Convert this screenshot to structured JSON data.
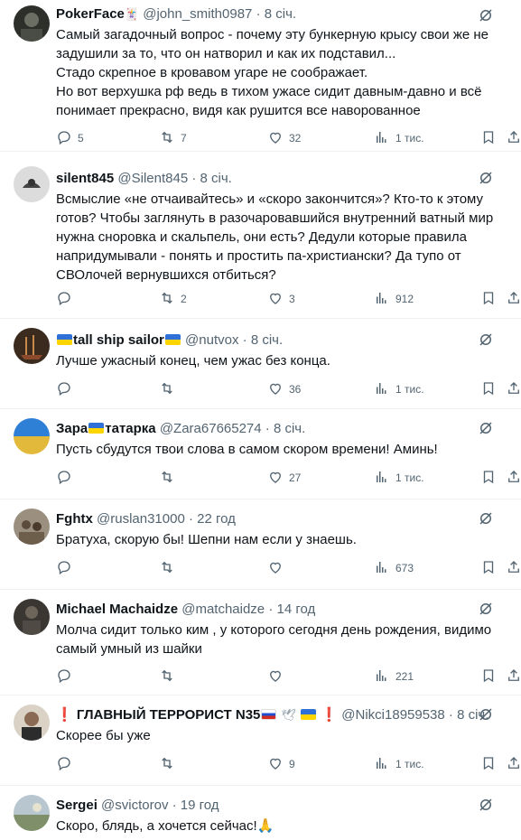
{
  "posts": [
    {
      "name": "PokerFace",
      "name_badge": "🃏",
      "handle": "@john_smith0987",
      "dot": "·",
      "time": "8 січ.",
      "text": "Самый загадочный вопрос - почему эту бункерную крысу свои же не\nзадушили за то, что он натворил и как их подставил...\nСтадо скрепное в кровавом угаре не соображает.\nНо вот верхушка рф ведь в тихом ужасе сидит давным-давно и всё\nпонимает прекрасно, видя как рушится все наворованное",
      "replies": "5",
      "reposts": "7",
      "likes": "32",
      "views": "1 тис."
    },
    {
      "name": "silent845",
      "handle": "@Silent845",
      "dot": "·",
      "time": "8 січ.",
      "text": "Всмыслие «не отчаивайтесь» и «скоро закончится»? Кто-то к этому\nготов? Чтобы заглянуть в разочаровавшийся внутренний ватный мир\nнужна сноровка и скальпель, они есть? Дедули которые правила\nнапридумывали - понять и простить па-христиански? Да тупо от\nСВОлочей вернувшихся отбиться?",
      "replies": "",
      "reposts": "2",
      "likes": "3",
      "views": "912"
    },
    {
      "name": "tall ship sailor",
      "handle": "@nutvox",
      "dot": "·",
      "time": "8 січ.",
      "text": "Лучше ужасный конец, чем ужас без конца.",
      "replies": "",
      "reposts": "",
      "likes": "36",
      "views": "1 тис."
    },
    {
      "name_a": "Зара",
      "name_b": "татарка",
      "handle": "@Zara67665274",
      "dot": "·",
      "time": "8 січ.",
      "text": "Пусть сбудутся твои слова в самом скором времени! Аминь!",
      "replies": "",
      "reposts": "",
      "likes": "27",
      "views": "1 тис."
    },
    {
      "name": "Fghtx",
      "handle": "@ruslan31000",
      "dot": "·",
      "time": "22 год",
      "text": "Братуха, скорую бы! Шепни нам если у знаешь.",
      "replies": "",
      "reposts": "",
      "likes": "",
      "views": "673"
    },
    {
      "name": "Michael Machaidze",
      "handle": "@matchaidze",
      "dot": "·",
      "time": "14 год",
      "text": "Молча сидит только ким , у которого сегодня день рождения,  видимо\nсамый умный из шайки",
      "replies": "",
      "reposts": "",
      "likes": "",
      "views": "221"
    },
    {
      "name_prefix": "❗",
      "name": "ГЛАВНЫЙ ТЕРРОРИСТ N35",
      "name_suffix_dove": "🕊",
      "name_suffix": "❗",
      "handle": "@Nikci18959538",
      "dot": "·",
      "time": "8 січ.",
      "text": "Скорее бы уже",
      "replies": "",
      "reposts": "",
      "likes": "9",
      "views": "1 тис."
    },
    {
      "name": "Sergei",
      "handle": "@svictorov",
      "dot": "·",
      "time": "19 год",
      "text": "Скоро, блядь, а хочется сейчас!",
      "text_emoji": "🙏"
    }
  ],
  "icons": {
    "reply": "reply-icon",
    "repost": "repost-icon",
    "like": "like-icon",
    "views": "views-icon",
    "bookmark": "bookmark-icon",
    "share": "share-icon",
    "grok": "grok-icon",
    "more": "more-icon"
  },
  "colors": {
    "text": "#0f1419",
    "secondary": "#536471",
    "divider": "#eff3f4"
  }
}
